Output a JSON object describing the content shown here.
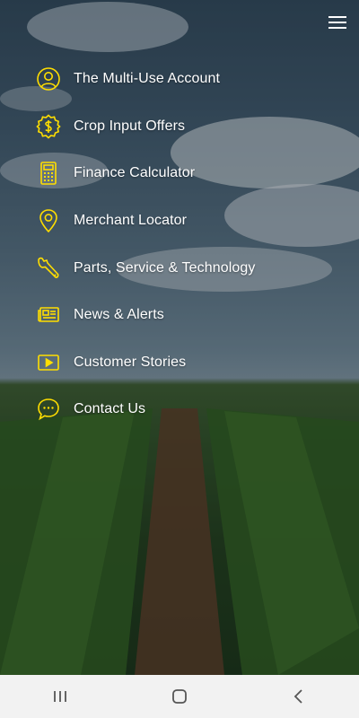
{
  "menu": {
    "items": [
      {
        "label": "The Multi-Use Account",
        "icon": "user-circle-icon"
      },
      {
        "label": "Crop Input Offers",
        "icon": "dollar-badge-icon"
      },
      {
        "label": "Finance Calculator",
        "icon": "calculator-icon"
      },
      {
        "label": "Merchant Locator",
        "icon": "map-pin-icon"
      },
      {
        "label": "Parts, Service & Technology",
        "icon": "wrench-icon"
      },
      {
        "label": "News & Alerts",
        "icon": "newspaper-icon"
      },
      {
        "label": "Customer Stories",
        "icon": "play-video-icon"
      },
      {
        "label": "Contact Us",
        "icon": "chat-bubble-icon"
      }
    ]
  },
  "colors": {
    "accent": "#FFDE00",
    "text": "#FFFFFF",
    "navbar_bg": "#F2F2F2"
  },
  "system_nav": {
    "buttons": [
      "recent-apps",
      "home",
      "back"
    ]
  }
}
